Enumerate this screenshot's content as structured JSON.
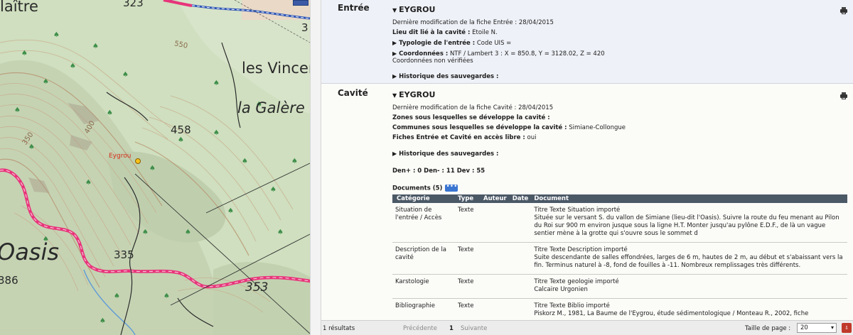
{
  "map": {
    "labels": {
      "laitre": "laître",
      "num_323": "323",
      "num_3": "3",
      "les_vincen": "les Vincen",
      "la_galere": "la Galère",
      "num_458": "458",
      "num_550": "550",
      "num_400": "400",
      "num_350": "350",
      "eygrou": "Eygrou",
      "oasis": "Oasis",
      "num_335": "335",
      "num_386": "386",
      "num_353": "353"
    }
  },
  "entree": {
    "section_label": "Entrée",
    "title": "EYGROU",
    "modif_label": "Dernière modification de la fiche Entrée :",
    "modif_value": "28/04/2015",
    "lieu_label": "Lieu dit lié à la cavité :",
    "lieu_value": "Etoile N.",
    "typologie_label": "Typologie de l'entrée :",
    "typologie_value": "Code UIS =",
    "coord_label": "Coordonnées :",
    "coord_value": "NTF / Lambert 3 : X = 850.8, Y = 3128.02, Z = 420",
    "coord_note": "Coordonnées non vérifiées",
    "historique": "Historique des sauvegardes :"
  },
  "cavite": {
    "section_label": "Cavité",
    "title": "EYGROU",
    "modif_label": "Dernière modification de la fiche Cavité :",
    "modif_value": "28/04/2015",
    "zones_label": "Zones sous lesquelles se développe la cavité :",
    "communes_label": "Communes sous lesquelles se développe la cavité :",
    "communes_value": "Simiane-Collongue",
    "fiches_label": "Fiches Entrée et Cavité en accès libre :",
    "fiches_value": "oui",
    "historique": "Historique des sauvegardes :",
    "den_line": "Den+ : 0 Den- : 11 Dev : 55",
    "documents_label": "Documents (5)",
    "more_button": "•••"
  },
  "documents": {
    "headers": [
      "Catégorie",
      "Type",
      "Auteur",
      "Date",
      "Document"
    ],
    "rows": [
      {
        "categorie": "Situation de l'entrée / Accès",
        "type": "Texte",
        "auteur": "",
        "date": "",
        "doc_title": "Titre Texte Situation importé",
        "doc_body": "Située sur le versant S. du vallon de Simiane (lieu-dit l'Oasis). Suivre la route du feu menant au Pilon du Roi sur 900 m environ jusque sous la ligne H.T. Monter jusqu'au pylône E.D.F., de là un vague sentier mène à la grotte qui s'ouvre sous le sommet d"
      },
      {
        "categorie": "Description de la cavité",
        "type": "Texte",
        "auteur": "",
        "date": "",
        "doc_title": "Titre Texte Description importé",
        "doc_body": "Suite descendante de salles effondrées, larges de 6 m, hautes de 2 m, au début et s'abaissant vers la fin. Terminus naturel à -8, fond de fouilles à -11. Nombreux remplissages très différents."
      },
      {
        "categorie": "Karstologie",
        "type": "Texte",
        "auteur": "",
        "date": "",
        "doc_title": "Titre Texte geologie importé",
        "doc_body": "Calcaire Urgonien"
      },
      {
        "categorie": "Bibliographie",
        "type": "Texte",
        "auteur": "",
        "date": "",
        "doc_title": "Titre Texte Biblio importé",
        "doc_body": "Piskorz M., 1981, La Baume de l'Eygrou, étude sédimentologique / Monteau R., 2002, fiche"
      }
    ]
  },
  "footer": {
    "results": "1 résultats",
    "previous": "Précédente",
    "page": "1",
    "next": "Suivante",
    "page_size_label": "Taille de page :",
    "page_size_value": "20"
  },
  "colors": {
    "map_green": "#cfe0c0",
    "road_pink": "#e8347a",
    "entree_bg": "#eef1f7",
    "table_header": "#4b5866",
    "accent_blue": "#3a76d1"
  }
}
